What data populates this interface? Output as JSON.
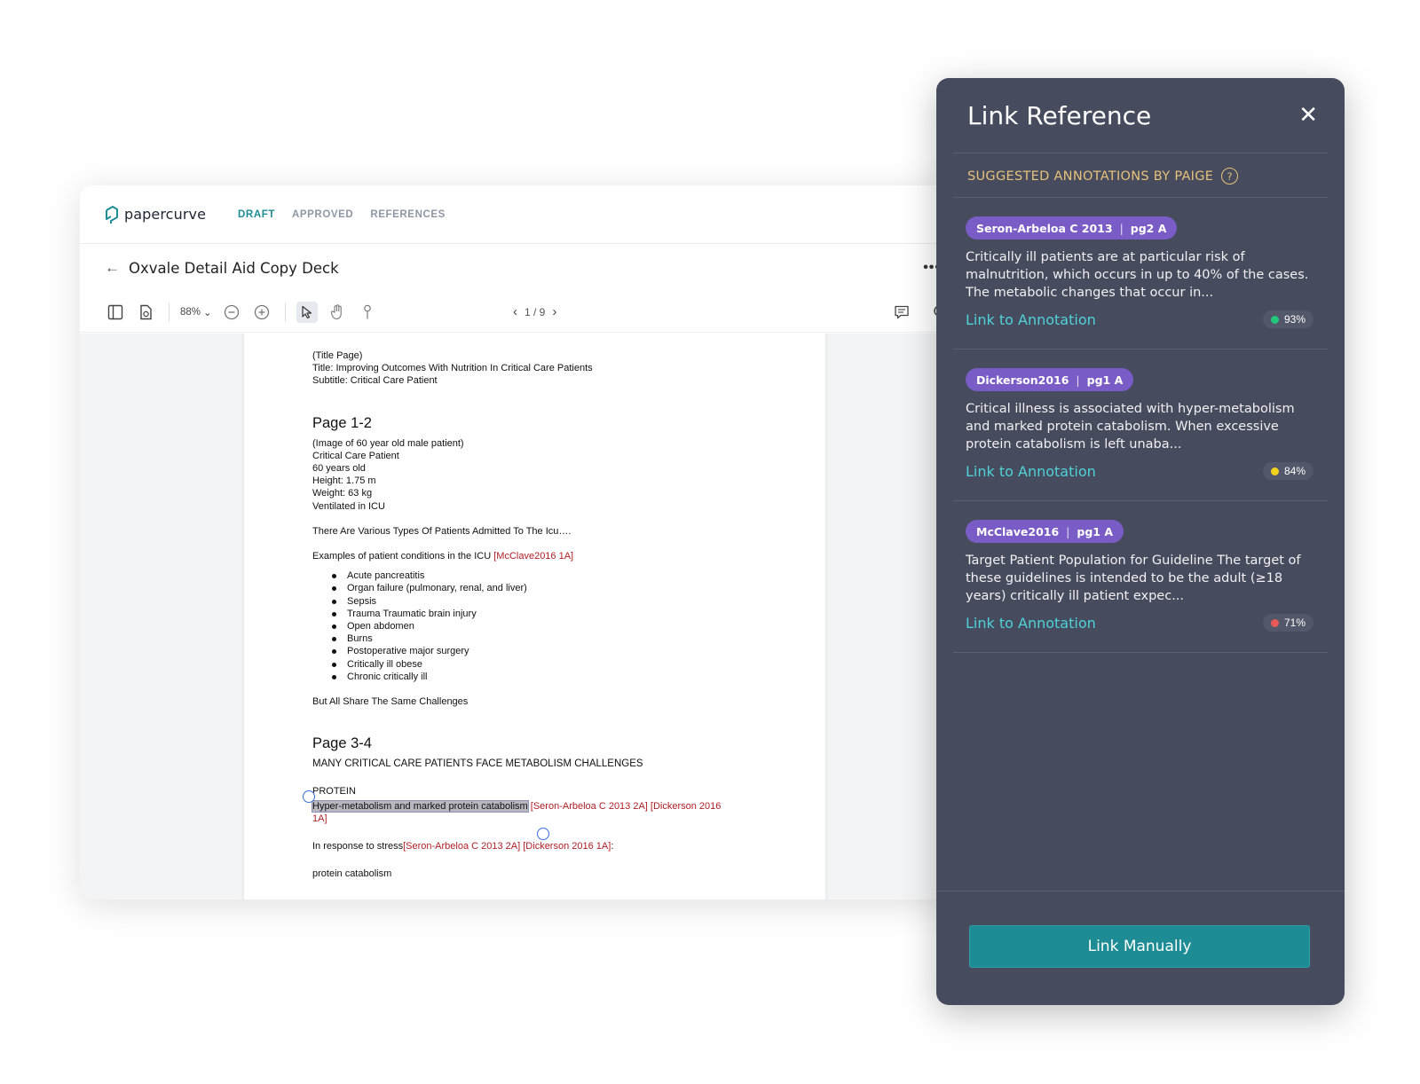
{
  "app": {
    "brand": "papercurve",
    "tabs": [
      {
        "label": "DRAFT",
        "active": true
      },
      {
        "label": "APPROVED",
        "active": false
      },
      {
        "label": "REFERENCES",
        "active": false
      }
    ],
    "doc_title": "Oxvale Detail Aid Copy Deck",
    "back_icon": "arrow-left-icon",
    "more_icon": "more-dots-icon"
  },
  "toolbar": {
    "zoom": "88%",
    "page_indicator": "1 / 9",
    "icons": [
      "sidebar-toggle-icon",
      "document-refresh-icon",
      "zoom-out-icon",
      "zoom-in-icon",
      "pointer-icon",
      "hand-icon",
      "pin-icon",
      "comments-icon",
      "search-icon"
    ]
  },
  "document": {
    "title_block": [
      "(Title Page)",
      "Title: Improving Outcomes With Nutrition In Critical Care Patients",
      "Subtitle: Critical Care Patient"
    ],
    "page12_heading": "Page 1-2",
    "patient_lines": [
      "(Image of 60 year old male patient)",
      "Critical Care Patient",
      "60 years old",
      "Height: 1.75 m",
      "Weight: 63 kg",
      "Ventilated in ICU"
    ],
    "various_types": "There Are Various Types Of Patients Admitted To The Icu….",
    "examples_text": "Examples of patient conditions in the ICU ",
    "examples_ref": "[McClave2016 1A]",
    "conditions": [
      "Acute pancreatitis",
      "Organ failure (pulmonary, renal, and liver)",
      "Sepsis",
      "Trauma Traumatic brain injury",
      "Open abdomen",
      "Burns",
      "Postoperative major surgery",
      "Critically ill obese",
      "Chronic critically ill"
    ],
    "same_challenges": "But All Share The Same Challenges",
    "page34_heading": "Page 3-4",
    "metabolism_heading": "MANY CRITICAL CARE PATIENTS FACE METABOLISM CHALLENGES",
    "protein_label": "PROTEIN",
    "highlighted": "Hyper-metabolism and marked protein catabolism",
    "highlight_refs_1": "[Seron-Arbeloa C 2013 2A] [Dickerson 2016",
    "highlight_refs_2": "1A]",
    "stress_text": "In response to stress",
    "stress_refs": "[Seron-Arbeloa C 2013 2A] [Dickerson 2016 1A]",
    "stress_end": ":",
    "protein_catabolism": "protein catabolism"
  },
  "panel": {
    "title": "Link Reference",
    "close_icon": "close-icon",
    "suggested_label": "SUGGESTED ANNOTATIONS BY PAIGE",
    "help_icon": "?",
    "cards": [
      {
        "source": "Seron-Arbeloa C 2013",
        "page": "pg2 A",
        "text": "Critically ill patients are at particular risk of malnutrition, which occurs in up to 40% of the cases. The  metabolic changes that occur in...",
        "link": "Link to Annotation",
        "score": "93%",
        "score_color": "#21c77a"
      },
      {
        "source": "Dickerson2016",
        "page": "pg1 A",
        "text": "Critical illness is associated with hyper-metabolism and marked protein catabolism. When excessive protein catabolism is left unaba...",
        "link": "Link to Annotation",
        "score": "84%",
        "score_color": "#f2d21b"
      },
      {
        "source": "McClave2016",
        "page": "pg1 A",
        "text": "Target Patient Population for Guideline The target of these guidelines is intended to be the adult (≥18 years) critically ill patient expec...",
        "link": "Link to Annotation",
        "score": "71%",
        "score_color": "#e85a5a"
      }
    ],
    "button": "Link Manually"
  }
}
